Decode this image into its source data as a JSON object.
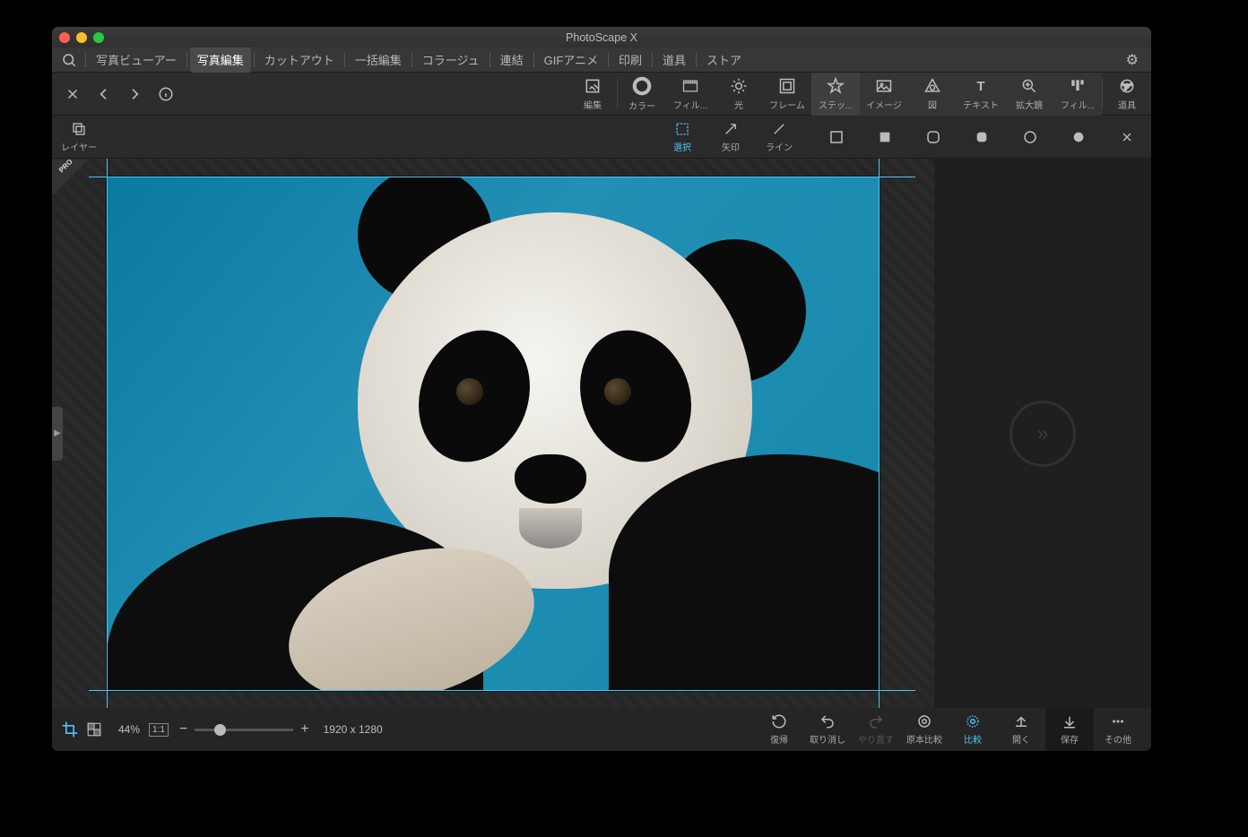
{
  "title": "PhotoScape X",
  "nav": {
    "items": [
      "写真ビューアー",
      "写真編集",
      "カットアウト",
      "一括編集",
      "コラージュ",
      "連結",
      "GIFアニメ",
      "印刷",
      "道具",
      "ストア"
    ],
    "active_index": 1
  },
  "toolbar": {
    "edit": "編集",
    "color": "カラー",
    "film": "フィル...",
    "light": "光",
    "frame": "フレーム",
    "sticker": "ステッ...",
    "image": "イメージ",
    "figure": "図",
    "text": "テキスト",
    "magnifier": "拡大鏡",
    "filter": "フィル...",
    "tools": "道具"
  },
  "subbar": {
    "layer": "レイヤー",
    "select": "選択",
    "arrow": "矢印",
    "line": "ライン"
  },
  "pro_badge": "PRO",
  "status": {
    "zoom": "44%",
    "one_to_one": "1:1",
    "dimensions": "1920 x 1280",
    "revert": "復帰",
    "undo": "取り消し",
    "redo": "やり直す",
    "compare_orig": "原本比較",
    "compare": "比較",
    "open": "開く",
    "save": "保存",
    "other": "その他"
  }
}
